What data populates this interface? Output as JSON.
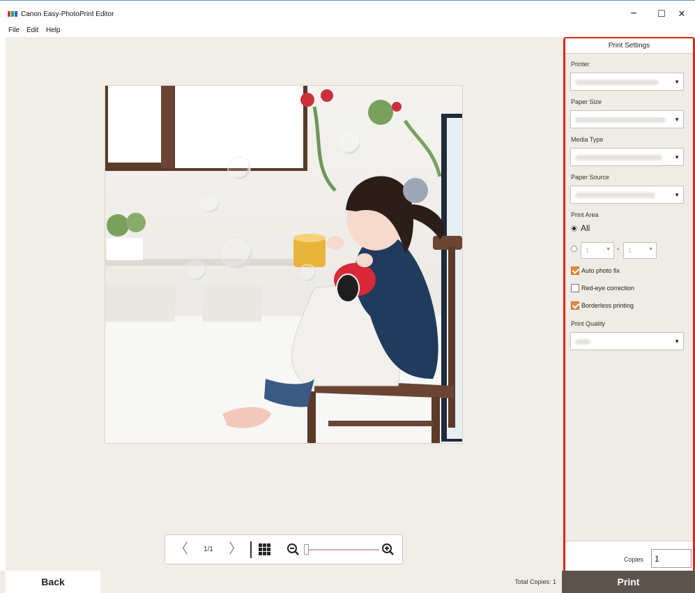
{
  "app": {
    "title": "Canon Easy-PhotoPrint Editor"
  },
  "window": {
    "minimize": "−",
    "maximize": "☐",
    "close": "✕"
  },
  "menu": [
    "File",
    "Edit",
    "Help"
  ],
  "toolbar": {
    "prev": "〈",
    "page": "1/1",
    "next": "〉",
    "zoom_out": "⊖",
    "zoom_in": "⊕",
    "zoom_level": 0.02
  },
  "bottom": {
    "back_label": "Back",
    "total_copies": "Total Copies: 1",
    "print_label": "Print"
  },
  "panel": {
    "title": "Print Settings",
    "printer_label": "Printer",
    "paper_size_label": "Paper Size",
    "media_type_label": "Media Type",
    "paper_source_label": "Paper Source",
    "print_area_label": "Print Area",
    "print_area_all": "All",
    "range_from": "1",
    "range_sep": "-",
    "range_to": "1",
    "auto_photo_fix": "Auto photo fix",
    "red_eye": "Red-eye correction",
    "borderless": "Borderless printing",
    "print_quality_label": "Print Quality",
    "copies_label": "Copies",
    "copies_value": "1"
  },
  "colors": {
    "accent_highlight": "#e2231a",
    "print_button": "#5c534d",
    "checkbox_checked": "#e8863b"
  }
}
